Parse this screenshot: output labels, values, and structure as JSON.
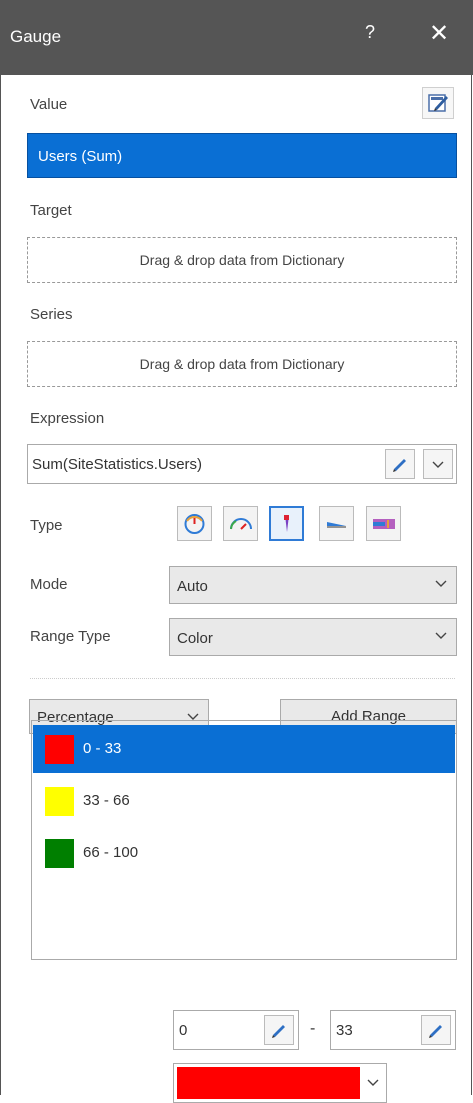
{
  "window": {
    "title": "Gauge",
    "help_label": "?",
    "close_label": "✕"
  },
  "value": {
    "label": "Value",
    "item": "Users (Sum)"
  },
  "target": {
    "label": "Target",
    "placeholder": "Drag & drop data from Dictionary"
  },
  "series": {
    "label": "Series",
    "placeholder": "Drag & drop data from Dictionary"
  },
  "expression": {
    "label": "Expression",
    "value": "Sum(SiteStatistics.Users)"
  },
  "type": {
    "label": "Type",
    "options": [
      "radial-gauge-icon",
      "half-circle-gauge-icon",
      "linear-needle-icon",
      "linear-bar-icon",
      "bullet-gauge-icon"
    ],
    "selected": "linear-needle-icon"
  },
  "mode": {
    "label": "Mode",
    "value": "Auto"
  },
  "range_type": {
    "label": "Range Type",
    "value": "Color"
  },
  "range_mode": {
    "value": "Percentage"
  },
  "add_range": {
    "label": "Add Range"
  },
  "ranges": [
    {
      "text": "0 - 33",
      "color": "#ff0000",
      "selected": true
    },
    {
      "text": "33 - 66",
      "color": "#ffff00",
      "selected": false
    },
    {
      "text": "66 - 100",
      "color": "#007f00",
      "selected": false
    }
  ],
  "range_edit": {
    "from": "0",
    "separator": "-",
    "to": "33",
    "color": "#ff0000"
  },
  "colors": {
    "accent": "#0a6fd4",
    "titlebar": "#555555"
  }
}
